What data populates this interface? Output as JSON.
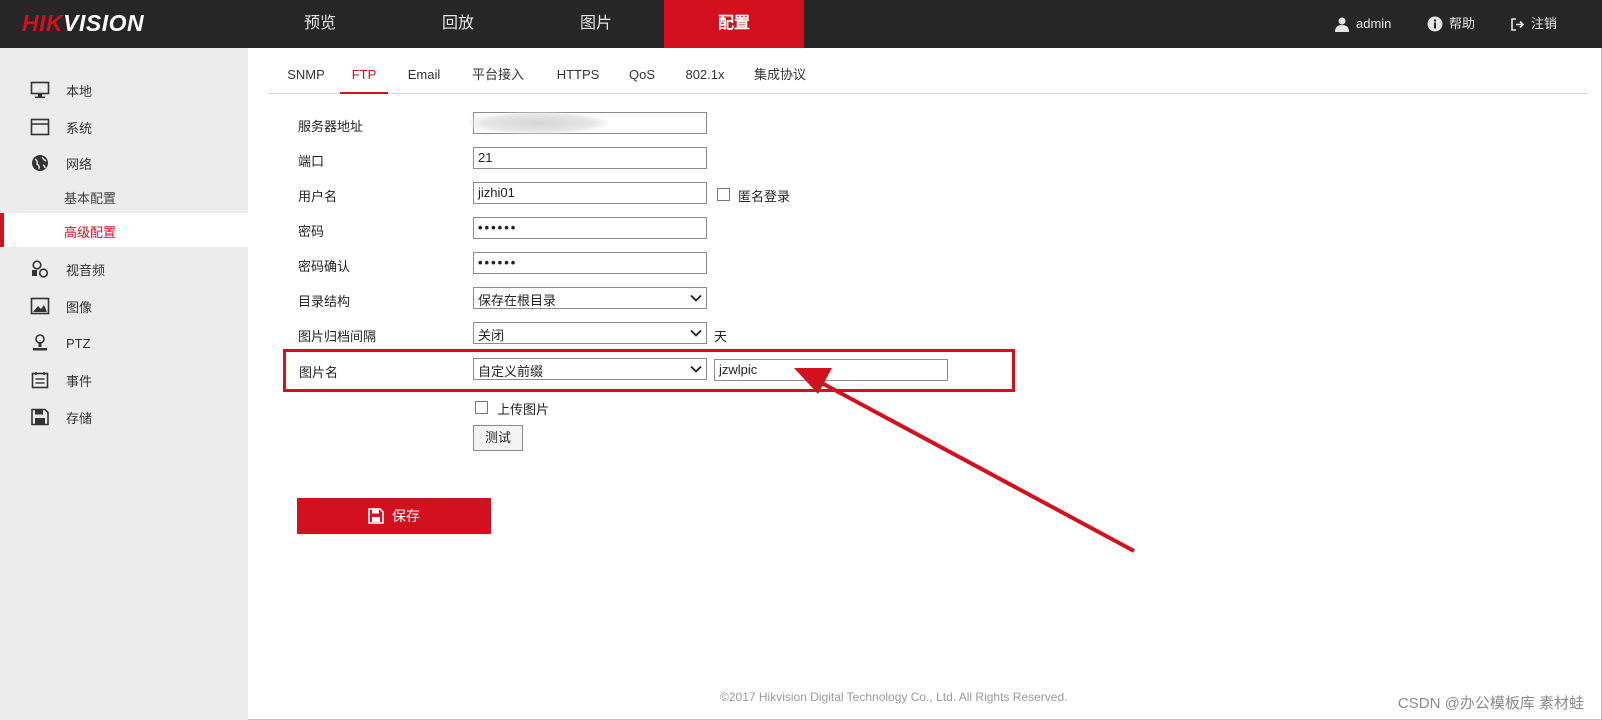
{
  "brand": {
    "logo_red": "HIK",
    "logo_white": "VISION"
  },
  "nav": {
    "items": [
      "预览",
      "回放",
      "图片",
      "配置"
    ],
    "active": "配置",
    "user": "admin",
    "help": "帮助",
    "logout": "注销"
  },
  "sidebar": {
    "items": [
      {
        "label": "本地",
        "icon": "monitor-icon"
      },
      {
        "label": "系统",
        "icon": "system-icon"
      },
      {
        "label": "网络",
        "icon": "globe-icon"
      },
      {
        "label": "基本配置",
        "sub": true
      },
      {
        "label": "高级配置",
        "sub": true,
        "active": true
      },
      {
        "label": "视音频",
        "icon": "media-icon"
      },
      {
        "label": "图像",
        "icon": "image-icon"
      },
      {
        "label": "PTZ",
        "icon": "ptz-icon"
      },
      {
        "label": "事件",
        "icon": "event-icon"
      },
      {
        "label": "存储",
        "icon": "storage-icon"
      }
    ]
  },
  "tabs": [
    "SNMP",
    "FTP",
    "Email",
    "平台接入",
    "HTTPS",
    "QoS",
    "802.1x",
    "集成协议"
  ],
  "active_tab": "FTP",
  "form": {
    "server_label": "服务器地址",
    "server_value": "",
    "port_label": "端口",
    "port_value": "21",
    "username_label": "用户名",
    "username_value": "jizhi01",
    "anonymous_label": "匿名登录",
    "password_label": "密码",
    "password_value": "••••••",
    "confirm_label": "密码确认",
    "confirm_value": "••••••",
    "dir_label": "目录结构",
    "dir_value": "保存在根目录",
    "archive_label": "图片归档间隔",
    "archive_value": "关闭",
    "archive_unit": "天",
    "picname_label": "图片名",
    "picname_mode": "自定义前缀",
    "picname_prefix": "jzwlpic",
    "upload_label": "上传图片",
    "test_button": "测试",
    "save_button": "保存"
  },
  "footer": "©2017 Hikvision Digital Technology Co., Ltd. All Rights Reserved.",
  "watermark": "CSDN @办公模板库 素材蛙",
  "colors": {
    "accent": "#d3101e",
    "topbar": "#262626",
    "sidebar": "#ececec"
  }
}
